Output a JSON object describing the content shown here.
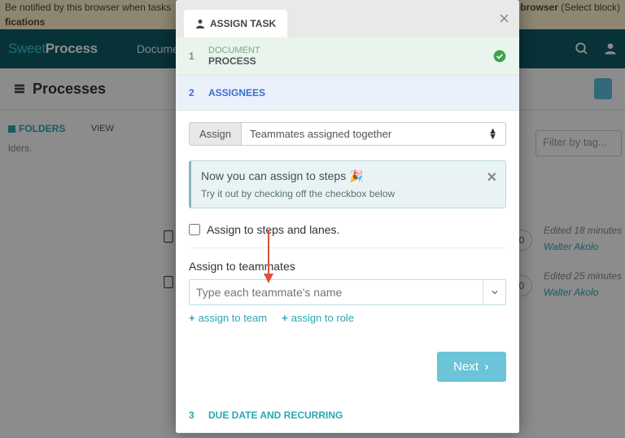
{
  "topbar": {
    "left_fragment_1": "Be notified by this browser when tasks",
    "left_fragment_2": "fications",
    "right_fragment_1": "browser",
    "right_fragment_2": " (Select block)"
  },
  "header": {
    "logo_a": "Sweet",
    "logo_b": "Process",
    "nav_docs": "Documen"
  },
  "subheader": {
    "title": "Processes"
  },
  "sidebar": {
    "folders_label": "FOLDERS",
    "view_label": "VIEW",
    "subtext": "lders."
  },
  "filter": {
    "placeholder": "Filter by tag..."
  },
  "list": [
    {
      "edited": "Edited 18 minutes",
      "author": "Walter Akolo",
      "count": "0"
    },
    {
      "edited": "Edited 25 minutes",
      "author": "Walter Akolo",
      "count": "0"
    }
  ],
  "modal": {
    "tab_label": "ASSIGN TASK",
    "steps": [
      {
        "num": "1",
        "small": "DOCUMENT",
        "label": "PROCESS"
      },
      {
        "num": "2",
        "label": "ASSIGNEES"
      },
      {
        "num": "3",
        "label": "DUE DATE AND RECURRING"
      }
    ],
    "assign_label": "Assign",
    "assign_mode": "Teammates assigned together",
    "info": {
      "title": "Now you can assign to steps 🎉",
      "subtitle": "Try it out by checking off the checkbox below"
    },
    "checkbox_label": "Assign to steps and lanes.",
    "assign_to_teammates": "Assign to teammates",
    "teammate_placeholder": "Type each teammate's name",
    "assign_to_team": "assign to team",
    "assign_to_role": "assign to role",
    "next": "Next"
  }
}
